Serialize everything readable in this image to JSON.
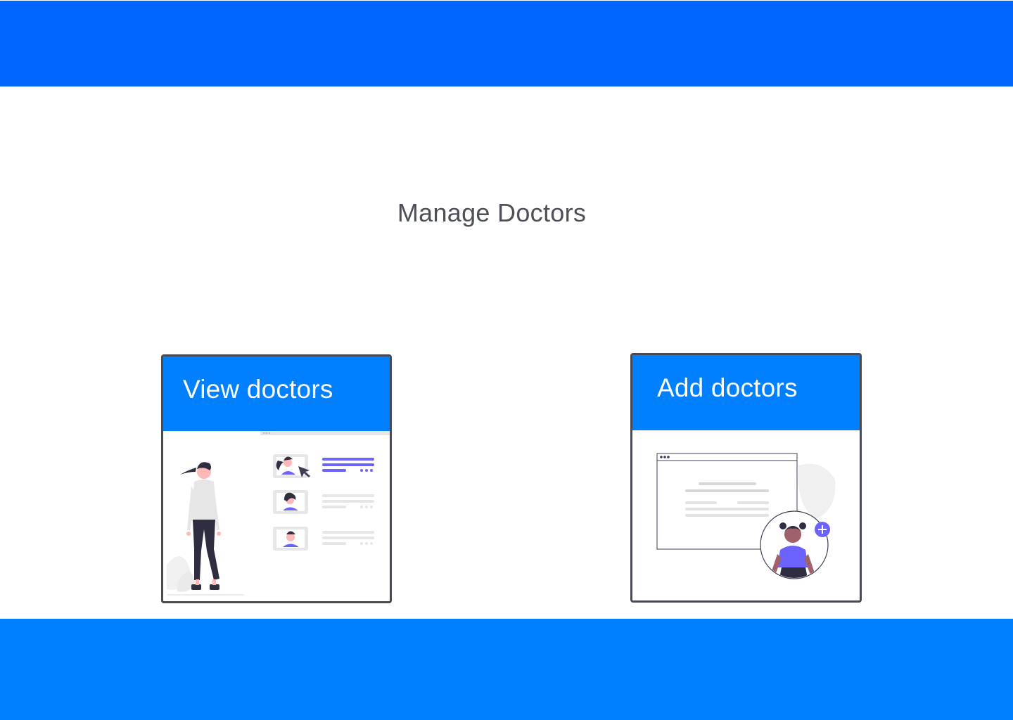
{
  "page": {
    "title": "Manage Doctors"
  },
  "cards": {
    "view": {
      "label": "View doctors",
      "illustration": "doctor-list-illustration"
    },
    "add": {
      "label": "Add doctors",
      "illustration": "add-doctor-illustration"
    }
  },
  "colors": {
    "header": "#0066ff",
    "footer": "#0080ff",
    "card_header": "#0080ff",
    "accent_purple": "#6c63ff",
    "card_border": "#4a4a55"
  }
}
